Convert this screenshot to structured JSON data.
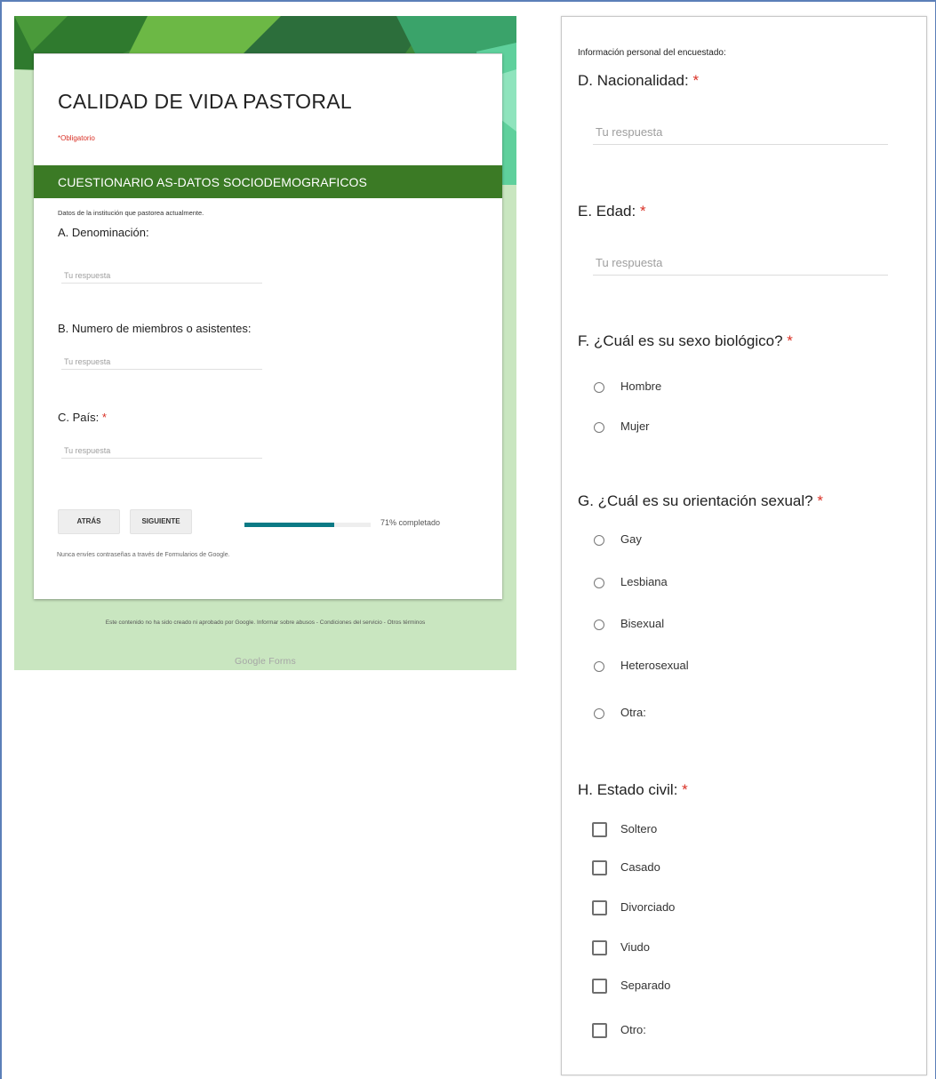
{
  "left_form": {
    "title": "CALIDAD DE VIDA PASTORAL",
    "required_note": "*Obligatorio",
    "section_title": "CUESTIONARIO AS-DATOS SOCIODEMOGRAFICOS",
    "section_description": "Datos de la institución que pastorea actualmente.",
    "questions": [
      {
        "label": "A. Denominación:",
        "required": false,
        "placeholder": "Tu respuesta"
      },
      {
        "label": "B. Numero de miembros o asistentes:",
        "required": false,
        "placeholder": "Tu respuesta"
      },
      {
        "label": "C. País:",
        "required": true,
        "placeholder": "Tu respuesta"
      }
    ],
    "back_button": "ATRÁS",
    "next_button": "SIGUIENTE",
    "progress_percent": 71,
    "progress_text": "71% completado",
    "never_submit_passwords": "Nunca envíes contraseñas a través de Formularios de Google.",
    "footer": "Este contenido no ha sido creado ni aprobado por Google. Informar sobre abusos - Condiciones del servicio - Otros términos",
    "brand": "Google Forms",
    "colors": {
      "header_green": "#3b7a25",
      "background_green": "#c9e6c0",
      "progress_teal": "#0b7a85",
      "required_red": "#d93025"
    }
  },
  "right_form": {
    "section_description": "Información personal del encuestado:",
    "required_mark": "*",
    "nationality": {
      "label": "D. Nacionalidad:",
      "placeholder": "Tu respuesta"
    },
    "age": {
      "label": "E. Edad:",
      "placeholder": "Tu respuesta"
    },
    "sex": {
      "label": "F. ¿Cuál es su sexo biológico?",
      "options": [
        "Hombre",
        "Mujer"
      ]
    },
    "orientation": {
      "label": "G. ¿Cuál es su orientación sexual?",
      "options": [
        "Gay",
        "Lesbiana",
        "Bisexual",
        "Heterosexual",
        "Otra:"
      ]
    },
    "marital": {
      "label": "H. Estado civil:",
      "options": [
        "Soltero",
        "Casado",
        "Divorciado",
        "Viudo",
        "Separado",
        "Otro:"
      ]
    }
  }
}
